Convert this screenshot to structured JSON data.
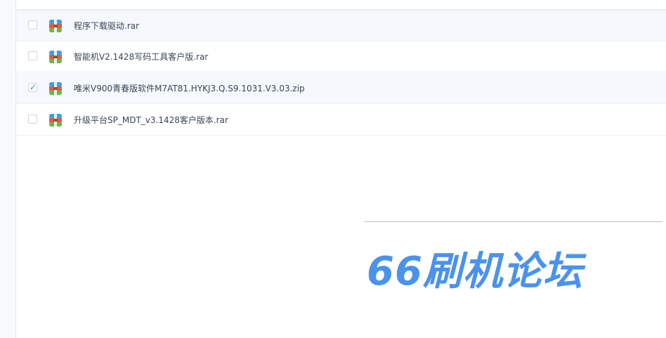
{
  "files": [
    {
      "name": "程序下载驱动.rar",
      "checked": false
    },
    {
      "name": "智能机V2.1428写码工具客户版.rar",
      "checked": false
    },
    {
      "name": "唯米V900青春版软件M7AT81.HYKJ3.Q.S9.1031.V3.03.zip",
      "checked": true
    },
    {
      "name": "升级平台SP_MDT_v3.1428客户版本.rar",
      "checked": false
    }
  ],
  "watermark": "66刷机论坛",
  "icons": {
    "file": "archive-icon",
    "check": "checkmark-icon"
  },
  "colors": {
    "accent": "#3b7fe0",
    "watermark": "#4a92ee",
    "row_alt": "#f5f8fd"
  }
}
